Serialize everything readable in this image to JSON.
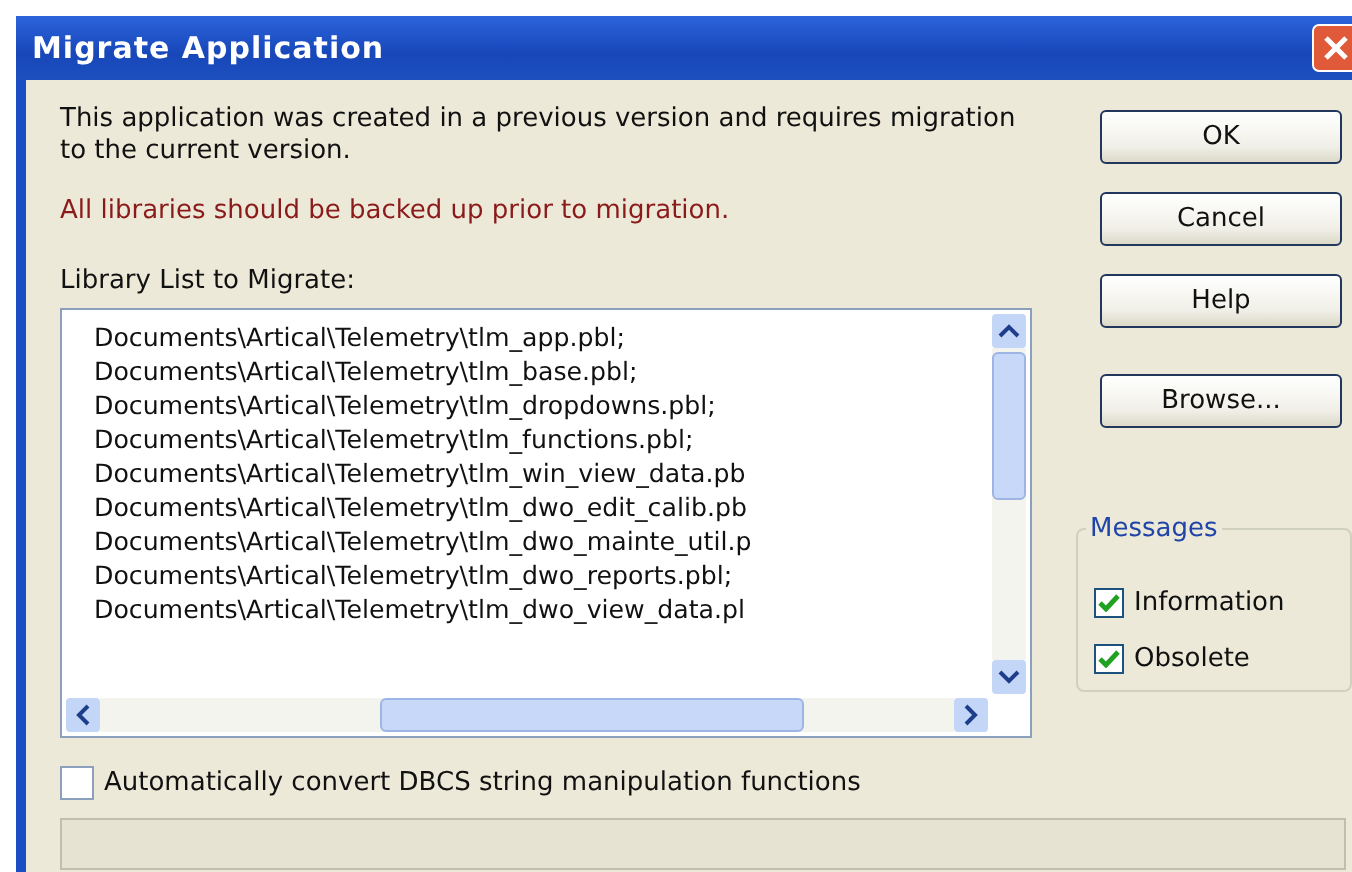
{
  "window": {
    "title": "Migrate Application"
  },
  "message": "This application was created in a previous version and requires migration to the current version.",
  "warning": "All libraries should be backed up prior to migration.",
  "library_list": {
    "label": "Library List to Migrate:",
    "items": [
      "Documents\\Artical\\Telemetry\\tlm_app.pbl;",
      "Documents\\Artical\\Telemetry\\tlm_base.pbl;",
      "Documents\\Artical\\Telemetry\\tlm_dropdowns.pbl;",
      "Documents\\Artical\\Telemetry\\tlm_functions.pbl;",
      "Documents\\Artical\\Telemetry\\tlm_win_view_data.pb",
      "Documents\\Artical\\Telemetry\\tlm_dwo_edit_calib.pb",
      "Documents\\Artical\\Telemetry\\tlm_dwo_mainte_util.p",
      "Documents\\Artical\\Telemetry\\tlm_dwo_reports.pbl;",
      "Documents\\Artical\\Telemetry\\tlm_dwo_view_data.pl"
    ]
  },
  "buttons": [
    "OK",
    "Cancel",
    "Help",
    "Browse..."
  ],
  "messages_group": {
    "title": "Messages",
    "options": [
      {
        "label": "Information",
        "checked": true
      },
      {
        "label": "Obsolete",
        "checked": true
      }
    ]
  },
  "dbcs_option": {
    "label": "Automatically convert DBCS string manipulation functions",
    "checked": false
  }
}
